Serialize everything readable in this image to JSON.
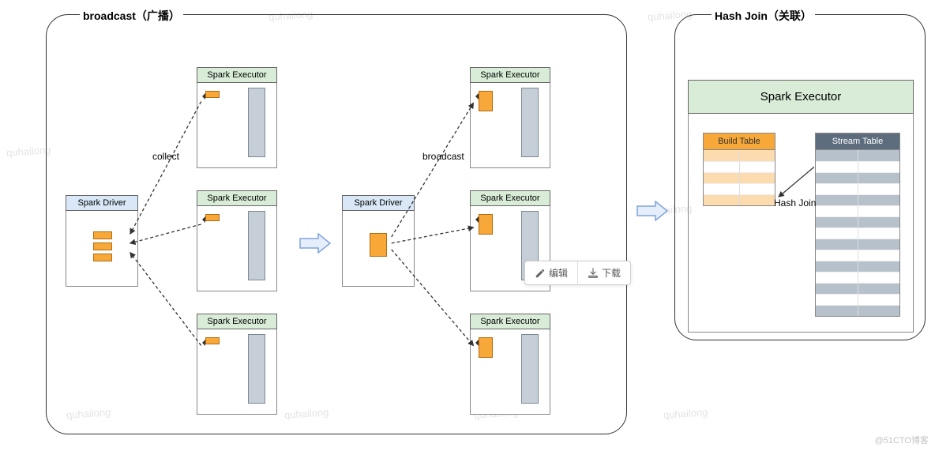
{
  "watermarks": [
    "quhailong",
    "quhailong",
    "quhailong",
    "quhailong",
    "quhailong",
    "quhailong",
    "quhailong",
    "quhailong",
    "quhailong"
  ],
  "left_panel": {
    "title": "broadcast（广播）",
    "driver_label": "Spark Driver",
    "executor_label": "Spark Executor",
    "collect_label": "collect",
    "broadcast_label": "broadcast"
  },
  "right_panel": {
    "title": "Hash Join（关联）",
    "executor_label": "Spark Executor",
    "build_table_label": "Build Table",
    "stream_table_label": "Stream Table",
    "hash_join_label": "Hash Join"
  },
  "toolbar": {
    "edit": "编辑",
    "download": "下载"
  },
  "credit": "@51CTO博客"
}
